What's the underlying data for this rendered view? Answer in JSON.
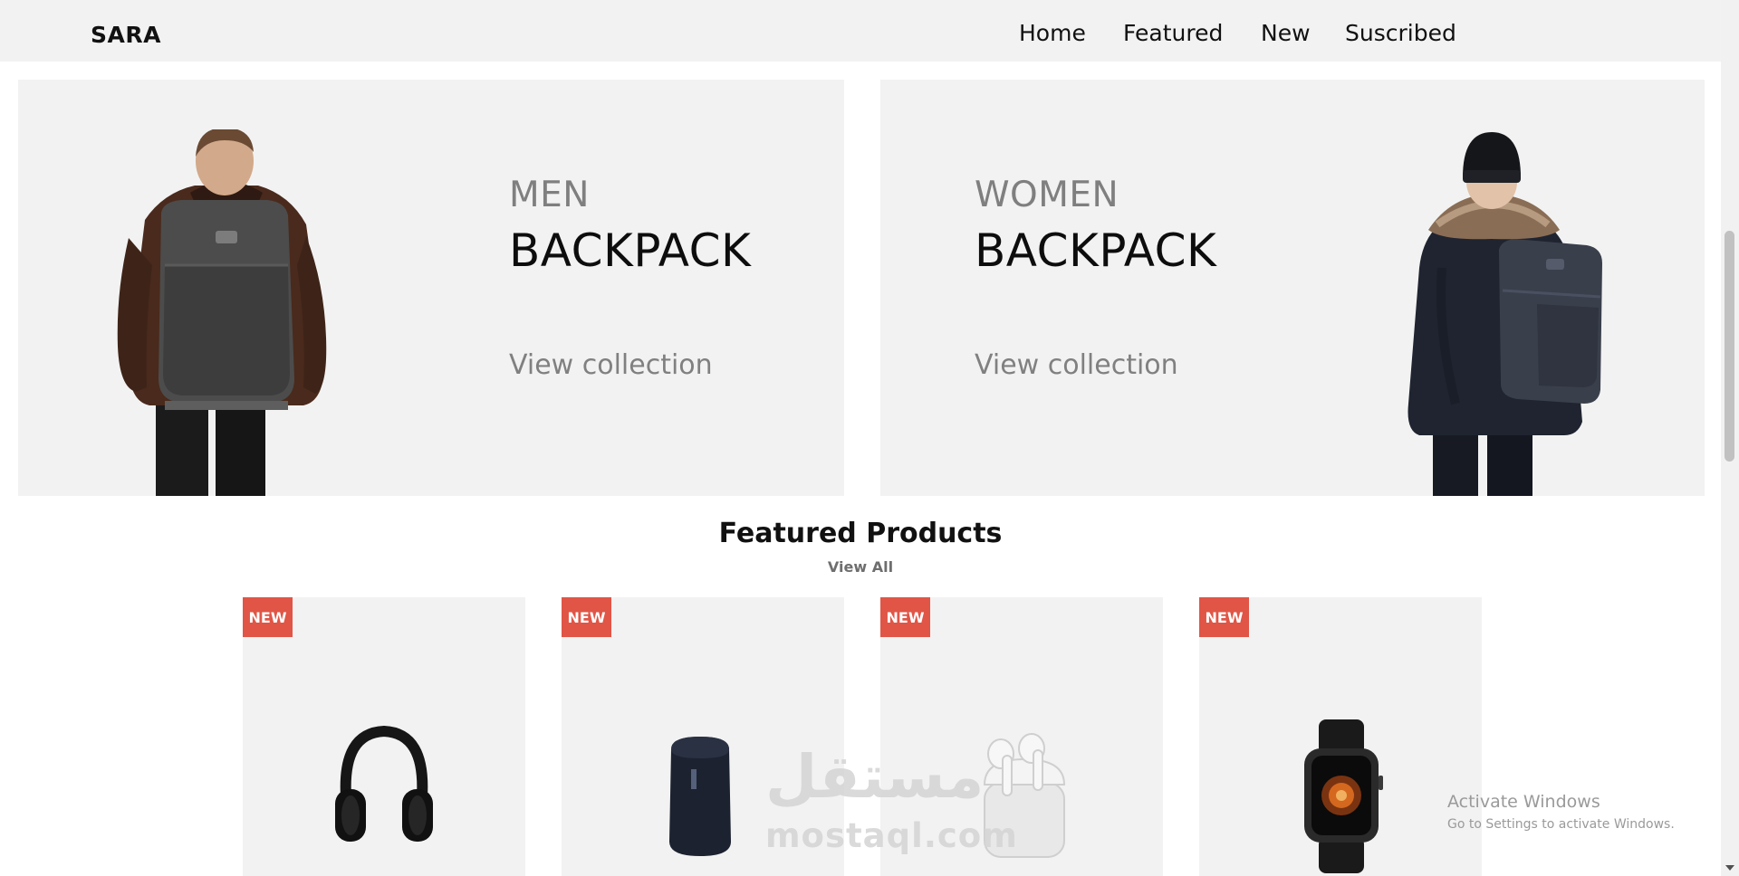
{
  "navbar": {
    "brand": "SARA",
    "links": [
      {
        "label": "Home"
      },
      {
        "label": "Featured"
      },
      {
        "label": "New"
      },
      {
        "label": "Suscribed"
      }
    ]
  },
  "hero": {
    "men": {
      "line1": "MEN",
      "line2": "BACKPACK",
      "link": "View collection",
      "image": "man-with-backpack-image"
    },
    "women": {
      "line1": "WOMEN",
      "line2": "BACKPACK",
      "link": "View collection",
      "image": "woman-with-backpack-image"
    }
  },
  "featured": {
    "title": "Featured Products",
    "view_all": "View All",
    "products": [
      {
        "badge": "NEW",
        "image": "headphones-image"
      },
      {
        "badge": "NEW",
        "image": "smart-speaker-image"
      },
      {
        "badge": "NEW",
        "image": "earbuds-image"
      },
      {
        "badge": "NEW",
        "image": "smartwatch-image"
      }
    ]
  },
  "watermark": {
    "arabic": "مستقل",
    "latin": "mostaql.com"
  },
  "os_overlay": {
    "title": "Activate Windows",
    "subtitle": "Go to Settings to activate Windows."
  },
  "colors": {
    "card_background": "#f2f2f2",
    "badge": "#e05546",
    "muted_text": "#808080"
  }
}
